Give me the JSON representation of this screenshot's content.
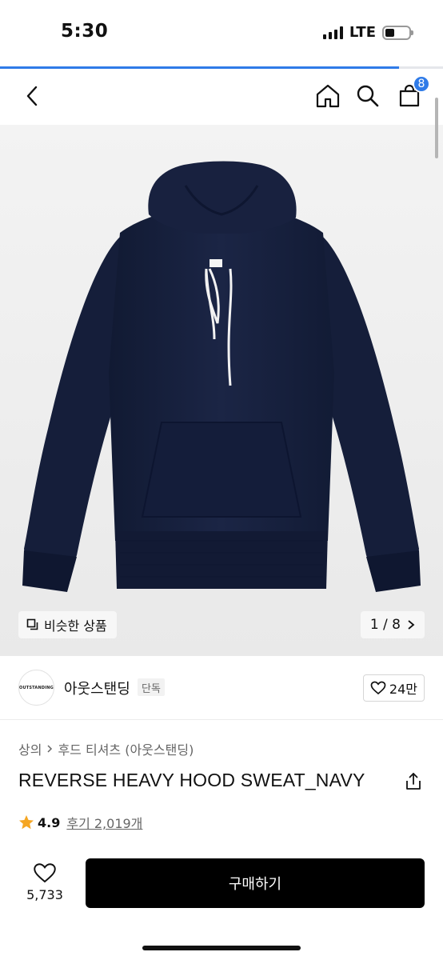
{
  "status_bar": {
    "time": "5:30",
    "network": "LTE"
  },
  "page_load_progress": 0.9,
  "nav": {
    "back_icon": "chevron-left-icon",
    "home_icon": "home-icon",
    "search_icon": "search-icon",
    "cart_icon": "shopping-bag-icon",
    "cart_count": "8"
  },
  "image": {
    "similar_label": "비슷한 상품",
    "pager_text": "1 / 8",
    "colors": {
      "hoodie": "#17203d",
      "drawstring": "#f2f2f2",
      "background": "#efefef"
    }
  },
  "brand": {
    "logo_text": "OUTSTANDING",
    "name": "아웃스탠딩",
    "tag": "단독",
    "likes": "24만"
  },
  "product": {
    "breadcrumb": [
      "상의",
      "후드 티셔츠 (아웃스탠딩)"
    ],
    "title": "REVERSE HEAVY HOOD SWEAT_NAVY",
    "rating": "4.9",
    "review_link": "후기 2,019개"
  },
  "bottom": {
    "wish_count": "5,733",
    "buy_label": "구매하기"
  },
  "accent_color": "#2f7be8"
}
